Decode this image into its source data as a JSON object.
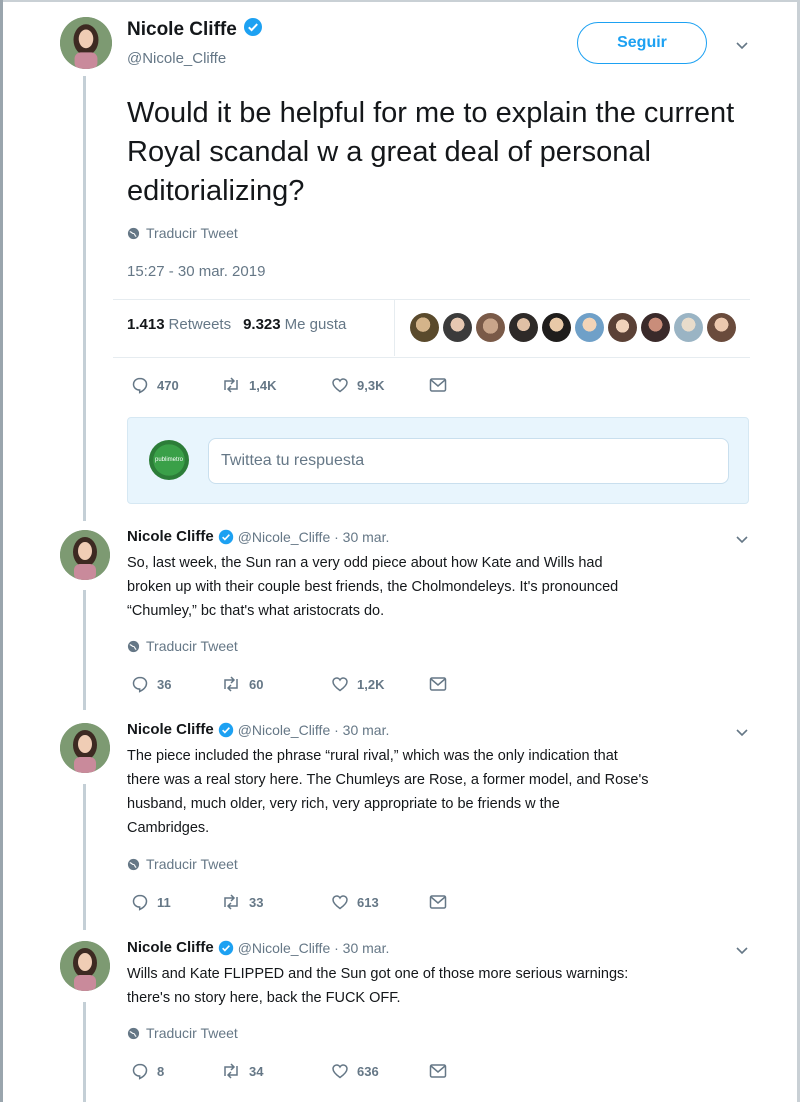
{
  "main_tweet": {
    "author_name": "Nicole Cliffe",
    "author_handle": "@Nicole_Cliffe",
    "follow_label": "Seguir",
    "text": "Would it be helpful for me to explain the current Royal scandal w a great deal of personal editorializing?",
    "translate_label": "Traducir Tweet",
    "timestamp": "15:27 - 30 mar. 2019",
    "retweets_count": "1.413",
    "retweets_label": "Retweets",
    "likes_count": "9.323",
    "likes_label": "Me gusta",
    "actions": {
      "replies": "470",
      "retweets": "1,4K",
      "likes": "9,3K"
    }
  },
  "reply_box": {
    "avatar_text": "publimetro",
    "placeholder": "Twittea tu respuesta"
  },
  "thread": [
    {
      "author_name": "Nicole Cliffe",
      "meta": "@Nicole_Cliffe · 30 mar.",
      "lines": [
        "So, last week, the Sun ran a very odd piece about how Kate and Wills had",
        "broken up with their couple best friends, the Cholmondeleys. It's pronounced",
        "“Chumley,” bc that's what aristocrats do."
      ],
      "translate_label": "Traducir Tweet",
      "actions": {
        "replies": "36",
        "retweets": "60",
        "likes": "1,2K"
      }
    },
    {
      "author_name": "Nicole Cliffe",
      "meta": "@Nicole_Cliffe · 30 mar.",
      "lines": [
        "The piece included the phrase “rural rival,” which was the only indication that",
        "there was a real story here. The Chumleys are Rose, a former model, and Rose's",
        "husband, much older, very rich, very appropriate to be friends w the",
        "Cambridges."
      ],
      "translate_label": "Traducir Tweet",
      "actions": {
        "replies": "11",
        "retweets": "33",
        "likes": "613"
      }
    },
    {
      "author_name": "Nicole Cliffe",
      "meta": "@Nicole_Cliffe · 30 mar.",
      "lines": [
        "Wills and Kate FLIPPED and the Sun got one of those more serious warnings:",
        "there's no story here, back the FUCK OFF."
      ],
      "translate_label": "Traducir Tweet",
      "actions": {
        "replies": "8",
        "retweets": "34",
        "likes": "636"
      }
    }
  ],
  "colors": {
    "accent": "#1da1f2",
    "text": "#14171a",
    "secondary": "#657786",
    "thread_line": "#c4cfd6"
  }
}
